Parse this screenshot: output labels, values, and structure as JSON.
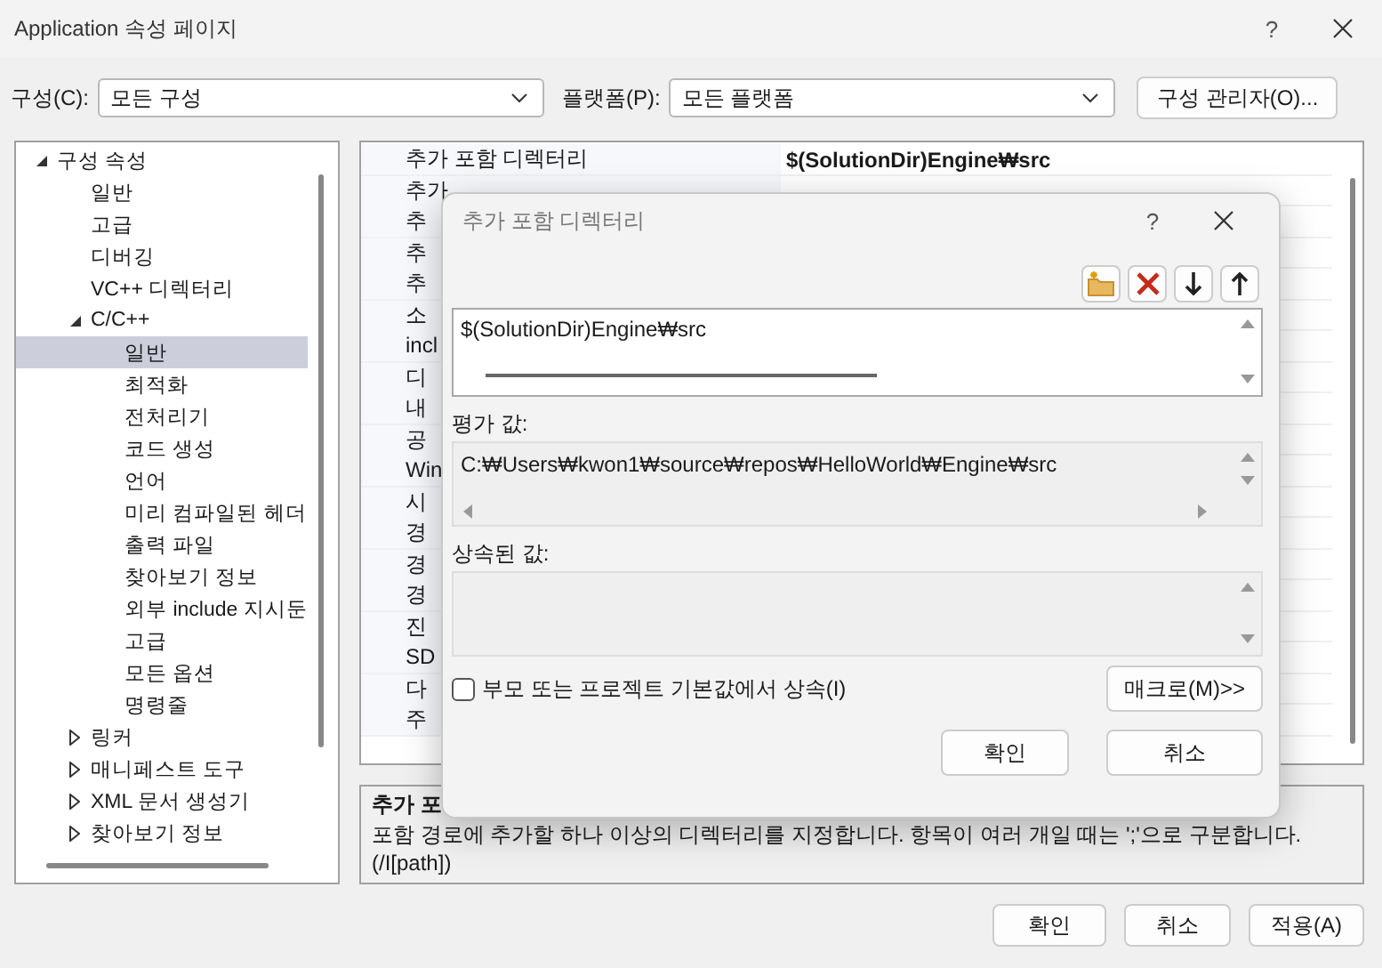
{
  "window": {
    "title": "Application 속성 페이지",
    "help": "?"
  },
  "configuration": {
    "label": "구성(C):",
    "value": "모든 구성"
  },
  "platform": {
    "label": "플랫폼(P):",
    "value": "모든 플랫폼"
  },
  "manager_button": "구성 관리자(O)...",
  "tree": [
    {
      "label": "구성 속성",
      "expanded": true,
      "selected": false,
      "children": [
        {
          "label": "일반",
          "selected": false
        },
        {
          "label": "고급",
          "selected": false
        },
        {
          "label": "디버깅",
          "selected": false
        },
        {
          "label": "VC++ 디렉터리",
          "selected": false
        },
        {
          "label": "C/C++",
          "expanded": true,
          "selected": false,
          "children": [
            {
              "label": "일반",
              "selected": true
            },
            {
              "label": "최적화",
              "selected": false
            },
            {
              "label": "전처리기",
              "selected": false
            },
            {
              "label": "코드 생성",
              "selected": false
            },
            {
              "label": "언어",
              "selected": false
            },
            {
              "label": "미리 컴파일된 헤더",
              "selected": false
            },
            {
              "label": "출력 파일",
              "selected": false
            },
            {
              "label": "찾아보기 정보",
              "selected": false
            },
            {
              "label": "외부 include 지시둔",
              "selected": false
            },
            {
              "label": "고급",
              "selected": false
            },
            {
              "label": "모든 옵션",
              "selected": false
            },
            {
              "label": "명령줄",
              "selected": false
            }
          ]
        },
        {
          "label": "링커",
          "expanded": false,
          "selected": false
        },
        {
          "label": "매니페스트 도구",
          "expanded": false,
          "selected": false
        },
        {
          "label": "XML 문서 생성기",
          "expanded": false,
          "selected": false
        },
        {
          "label": "찾아보기 정보",
          "expanded": false,
          "selected": false
        }
      ]
    }
  ],
  "properties": [
    {
      "name": "추가 포함 디렉터리",
      "value": "$(SolutionDir)Engine₩src"
    },
    {
      "name": "추가"
    },
    {
      "name": "추"
    },
    {
      "name": "추"
    },
    {
      "name": "추"
    },
    {
      "name": "소"
    },
    {
      "name": "incl"
    },
    {
      "name": "디"
    },
    {
      "name": "내"
    },
    {
      "name": "공"
    },
    {
      "name": "Win"
    },
    {
      "name": "시"
    },
    {
      "name": "경"
    },
    {
      "name": "경"
    },
    {
      "name": "경"
    },
    {
      "name": "진"
    },
    {
      "name": "SD"
    },
    {
      "name": "다"
    },
    {
      "name": "주"
    }
  ],
  "description": {
    "title": "추가 포",
    "text": "포함 경로에 추가할 하나 이상의 디렉터리를 지정합니다. 항목이 여러 개일 때는 ';'으로 구분합니다.\n(/I[path])"
  },
  "buttons": [
    "확인",
    "취소",
    "적용(A)"
  ],
  "dialog": {
    "title": "추가 포함 디렉터리",
    "help": "?",
    "entries": [
      "$(SolutionDir)Engine₩src"
    ],
    "evaluated_label": "평가 값:",
    "evaluated": "C:₩Users₩kwon1₩source₩repos₩HelloWorld₩Engine₩src",
    "inherited_label": "상속된 값:",
    "inherit": {
      "label": "부모 또는 프로젝트 기본값에서 상속(I)",
      "checked": false
    },
    "macro_button": "매크로(M)>>",
    "buttons": [
      "확인",
      "취소"
    ]
  }
}
